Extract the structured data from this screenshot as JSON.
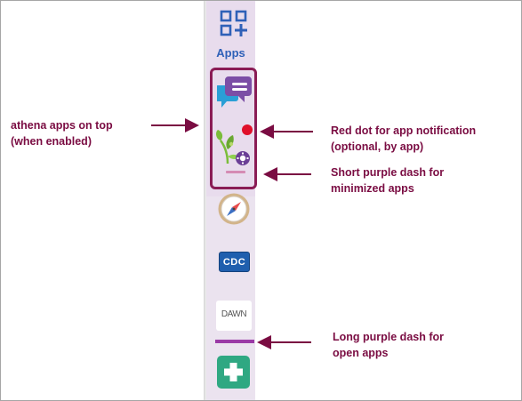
{
  "sidebar": {
    "apps_button": {
      "label": "Apps",
      "icon": "apps-grid-plus-icon"
    },
    "pinned_athena_apps": [
      {
        "icon": "chat-message-icon",
        "colors": {
          "back_bubble": "#2a9fd6",
          "front_bubble": "#7b4ea6"
        }
      },
      {
        "icon": "plant-settings-icon",
        "notification_dot": true,
        "minimized": true
      }
    ],
    "apps": [
      {
        "icon": "compass-icon"
      },
      {
        "icon": "cdc-logo-icon",
        "label": "CDC"
      },
      {
        "icon": "dawn-logo-icon",
        "label": "DAWN",
        "open": true
      },
      {
        "icon": "green-plus-icon"
      }
    ]
  },
  "annotations": {
    "athena_apps": [
      "athena apps on top",
      "(when enabled)"
    ],
    "red_dot": [
      "Red dot for app notification",
      "(optional, by app)"
    ],
    "short_dash": [
      "Short purple dash for",
      "minimized apps"
    ],
    "long_dash": [
      "Long purple dash for",
      "open apps"
    ]
  },
  "colors": {
    "annotation_text": "#7a0c42",
    "highlight_border": "#8a1c55",
    "sidebar_bg": "#e8dced",
    "notification_dot": "#e0102a",
    "short_dash": "#d58bb4",
    "long_dash": "#9b3aa6",
    "apps_blue": "#2f61b8"
  }
}
